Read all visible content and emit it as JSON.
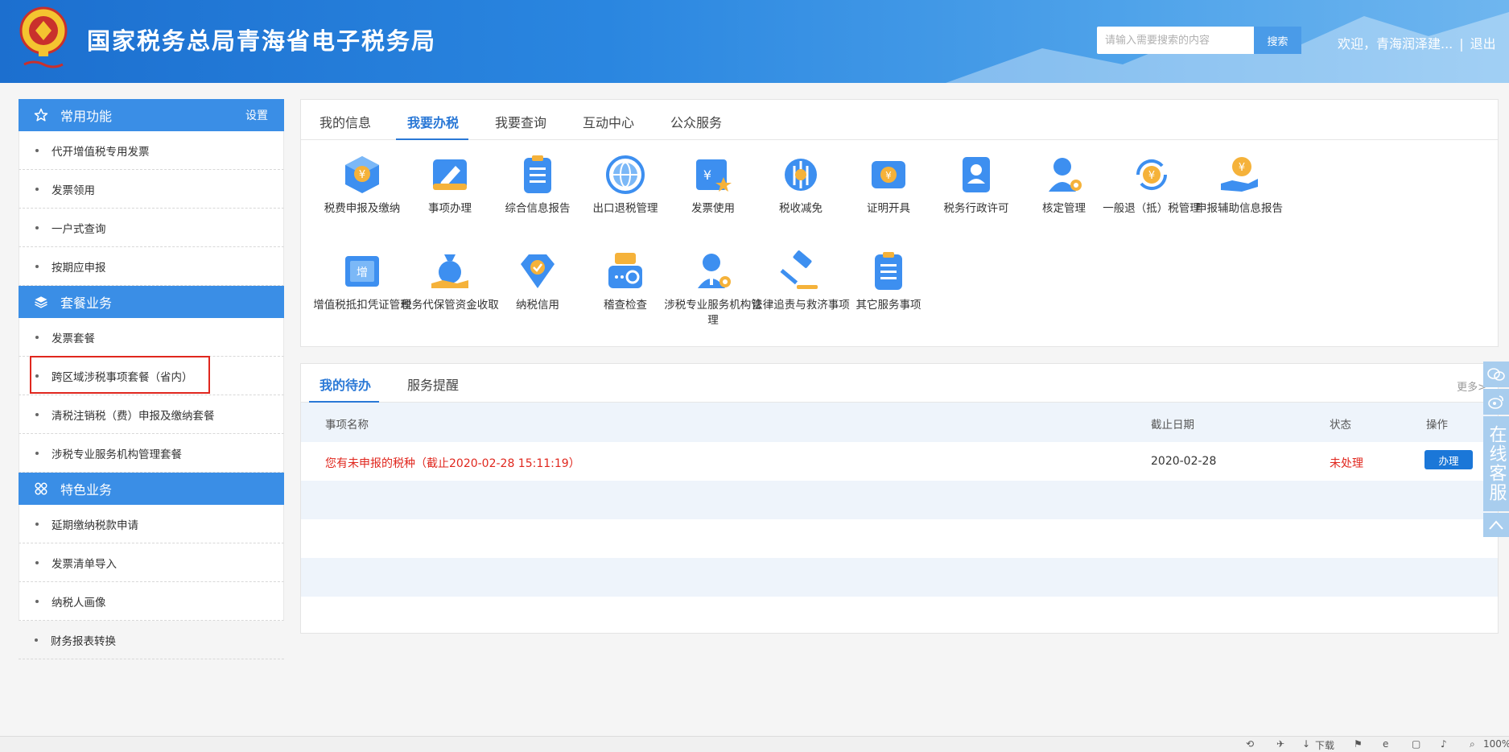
{
  "header": {
    "title": "国家税务总局青海省电子税务局",
    "search_placeholder": "请输入需要搜索的内容",
    "search_button": "搜索",
    "welcome": "欢迎，青海润泽建...",
    "separator": "|",
    "logout": "退出"
  },
  "sidebar": {
    "sections": [
      {
        "title": "常用功能",
        "action": "设置",
        "icon": "star-icon",
        "items": [
          "代开增值税专用发票",
          "发票领用",
          "一户式查询",
          "按期应申报"
        ]
      },
      {
        "title": "套餐业务",
        "icon": "layers-icon",
        "items": [
          "发票套餐",
          "跨区域涉税事项套餐（省内）",
          "清税注销税（费）申报及缴纳套餐",
          "涉税专业服务机构管理套餐"
        ]
      },
      {
        "title": "特色业务",
        "icon": "grid-icon",
        "items": [
          "延期缴纳税款申请",
          "发票清单导入",
          "纳税人画像",
          "财务报表转换"
        ]
      }
    ]
  },
  "main": {
    "tabs": [
      "我的信息",
      "我要办税",
      "我要查询",
      "互动中心",
      "公众服务"
    ],
    "active_tab": "我要办税",
    "services": [
      {
        "label": "税费申报及缴纳",
        "icon": "tax-box-icon"
      },
      {
        "label": "事项办理",
        "icon": "pencil-card-icon"
      },
      {
        "label": "综合信息报告",
        "icon": "clipboard-icon"
      },
      {
        "label": "出口退税管理",
        "icon": "globe-icon"
      },
      {
        "label": "发票使用",
        "icon": "invoice-star-icon"
      },
      {
        "label": "税收减免",
        "icon": "reduction-icon"
      },
      {
        "label": "证明开具",
        "icon": "certificate-icon"
      },
      {
        "label": "税务行政许可",
        "icon": "license-icon"
      },
      {
        "label": "核定管理",
        "icon": "user-gear-icon"
      },
      {
        "label": "一般退（抵）税管理",
        "icon": "refund-cycle-icon"
      },
      {
        "label": "申报辅助信息报告",
        "icon": "hand-coin-icon"
      },
      {
        "label": "增值税抵扣凭证管理",
        "icon": "vat-ticket-icon"
      },
      {
        "label": "税务代保管资金收取",
        "icon": "money-bag-icon"
      },
      {
        "label": "纳税信用",
        "icon": "diamond-check-icon"
      },
      {
        "label": "稽查检查",
        "icon": "inspection-icon"
      },
      {
        "label": "涉税专业服务机构管理",
        "icon": "agent-gear-icon"
      },
      {
        "label": "法律追责与救济事项",
        "icon": "gavel-icon"
      },
      {
        "label": "其它服务事项",
        "icon": "list-doc-icon"
      }
    ]
  },
  "todo": {
    "tabs": [
      "我的待办",
      "服务提醒"
    ],
    "more": "更多>",
    "columns": [
      "事项名称",
      "截止日期",
      "状态",
      "操作"
    ],
    "rows": [
      {
        "name": "您有未申报的税种（截止2020-02-28 15:11:19）",
        "deadline": "2020-02-28",
        "status": "未处理",
        "action": "办理"
      }
    ]
  },
  "float_service": {
    "label": "在线客服"
  },
  "statusbar": {
    "download": "下载",
    "zoom": "100%"
  },
  "colors": {
    "brand_blue": "#2a78d6",
    "header_blue": "#1c6fcf",
    "alert_red": "#e0271e",
    "sidebar_head": "#3a8ee6"
  }
}
